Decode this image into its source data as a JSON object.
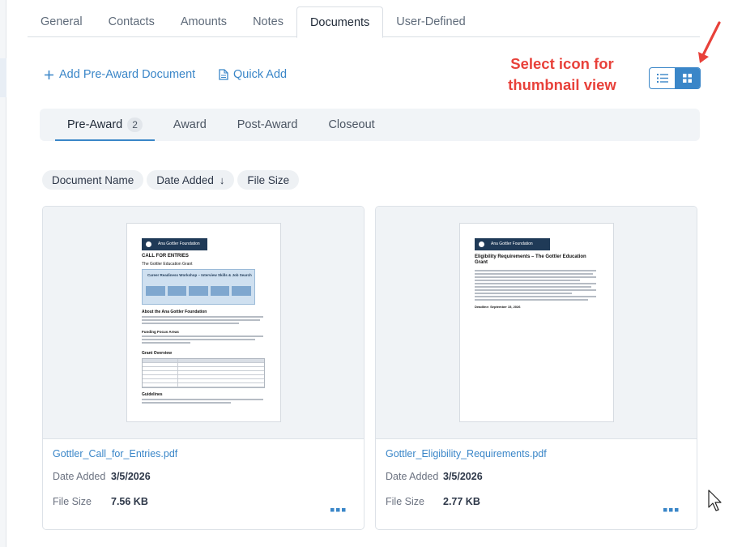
{
  "tabs": [
    {
      "label": "General"
    },
    {
      "label": "Contacts"
    },
    {
      "label": "Amounts"
    },
    {
      "label": "Notes"
    },
    {
      "label": "Documents",
      "active": true
    },
    {
      "label": "User-Defined"
    }
  ],
  "actions": {
    "add_pre_award": "Add Pre-Award Document",
    "quick_add": "Quick Add"
  },
  "annotation": {
    "line1": "Select icon for",
    "line2": "thumbnail view"
  },
  "view_toggle": {
    "list_icon": "list-icon",
    "grid_icon": "grid-icon",
    "selected": "grid"
  },
  "subtabs": [
    {
      "label": "Pre-Award",
      "count": "2",
      "active": true
    },
    {
      "label": "Award"
    },
    {
      "label": "Post-Award"
    },
    {
      "label": "Closeout"
    }
  ],
  "sort_chips": {
    "name": "Document Name",
    "date": "Date Added",
    "date_arrow": "↓",
    "size": "File Size"
  },
  "documents": [
    {
      "file_name": "Gottler_Call_for_Entries.pdf",
      "date_label": "Date Added",
      "date": "3/5/2026",
      "size_label": "File Size",
      "size": "7.56 KB",
      "thumb": {
        "org": "Ana Gottler Foundation",
        "heading": "CALL FOR ENTRIES",
        "subheading": "The Gottler Education Grant",
        "box_title": "Career Readiness Workshop – Interview Skills & Job Search",
        "section1": "About the Ana Gottler Foundation",
        "section2": "Funding Focus Areas",
        "section3": "Grant Overview",
        "section4": "Guidelines"
      }
    },
    {
      "file_name": "Gottler_Eligibility_Requirements.pdf",
      "date_label": "Date Added",
      "date": "3/5/2026",
      "size_label": "File Size",
      "size": "2.77 KB",
      "thumb": {
        "org": "Ana Gottler Foundation",
        "heading": "Eligibility Requirements – The Gottler Education Grant",
        "deadline": "Deadline: September 15, 2026"
      }
    }
  ],
  "colors": {
    "accent": "#3a86c8",
    "annotation": "#e8413a",
    "doc_header": "#1f3a57"
  }
}
